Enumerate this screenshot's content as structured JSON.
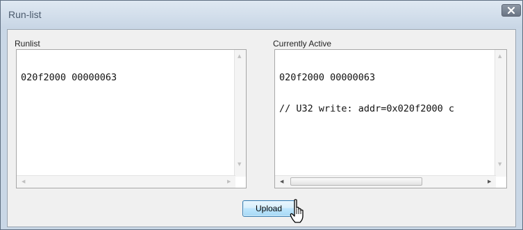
{
  "window": {
    "title": "Run-list"
  },
  "runlist": {
    "label": "Runlist",
    "lines": [
      "020f2000 00000063"
    ]
  },
  "active": {
    "label": "Currently Active",
    "lines": [
      "020f2000 00000063",
      "// U32 write: addr=0x020f2000 c"
    ]
  },
  "buttons": {
    "upload_label": "Upload"
  },
  "icons": {
    "close": "close-icon",
    "cursor": "hand-cursor-icon"
  }
}
